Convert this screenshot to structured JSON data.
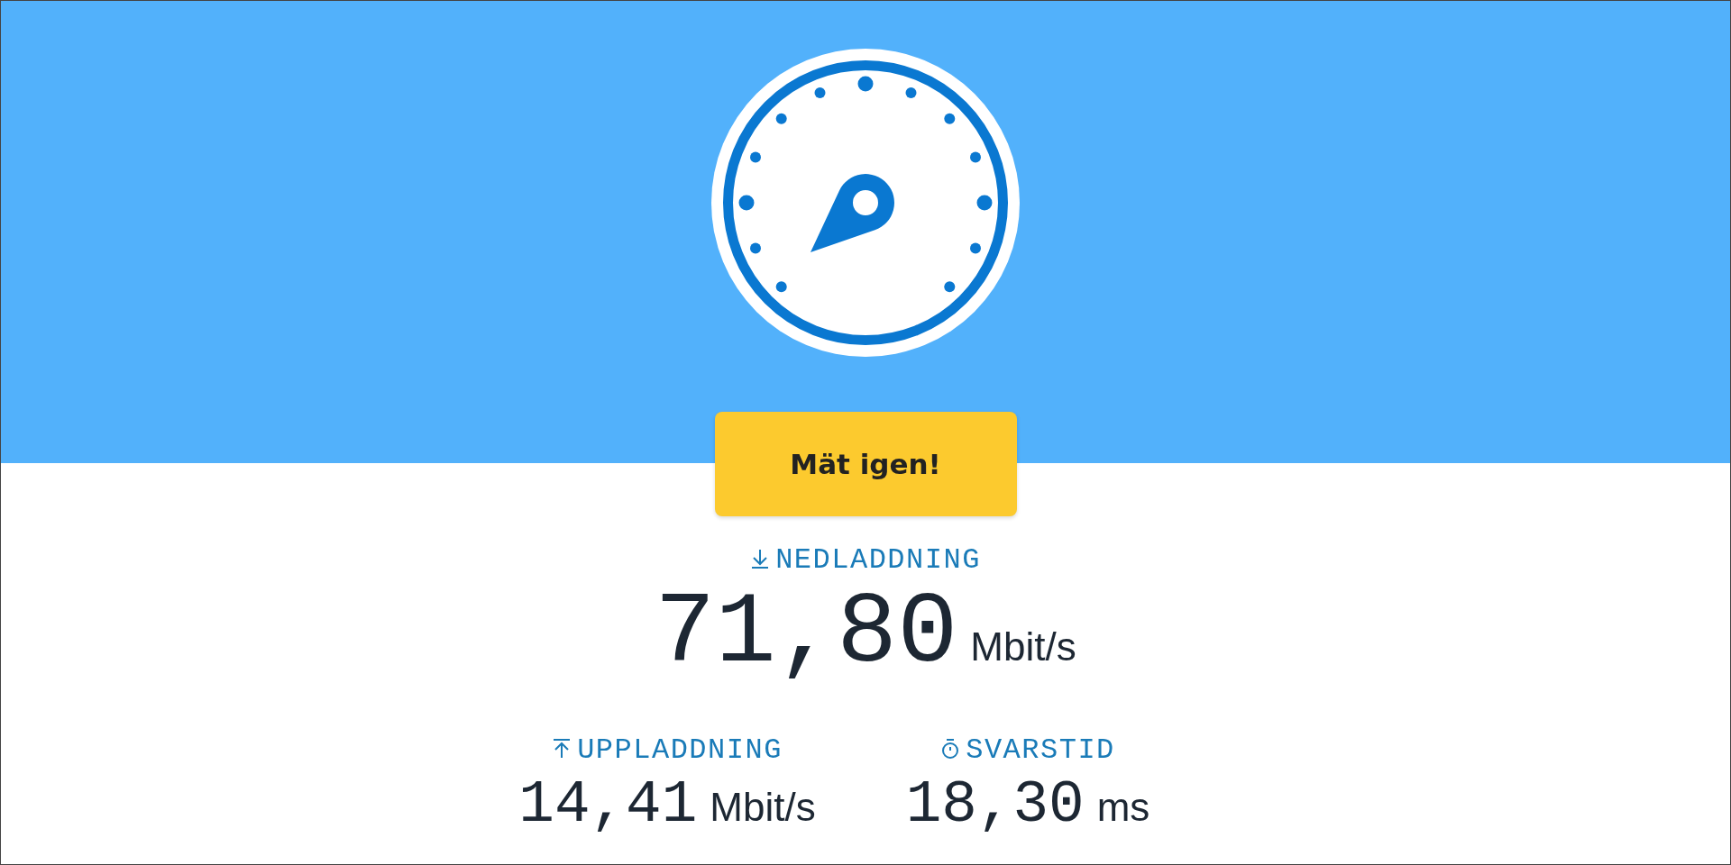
{
  "button": {
    "label": "Mät igen!"
  },
  "main_result": {
    "kind": "download",
    "label": "NEDLADDNING",
    "value": "71,80",
    "unit": "Mbit/s"
  },
  "results": [
    {
      "kind": "upload",
      "label": "UPPLADDNING",
      "value": "14,41",
      "unit": "Mbit/s"
    },
    {
      "kind": "latency",
      "label": "SVARSTID",
      "value": "18,30",
      "unit": "ms"
    }
  ]
}
